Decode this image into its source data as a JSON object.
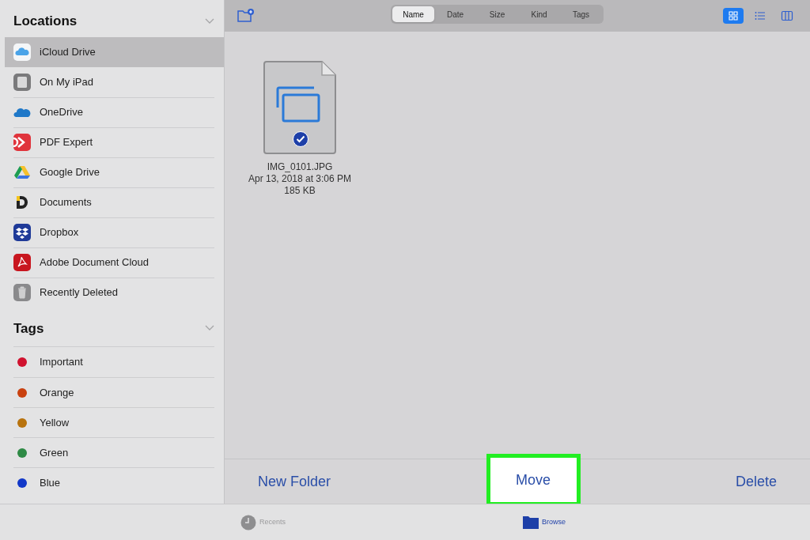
{
  "sidebar": {
    "sections": [
      {
        "title": "Locations",
        "kind": "locations",
        "items": [
          {
            "label": "iCloud Drive",
            "selected": true
          },
          {
            "label": "On My iPad",
            "selected": false
          },
          {
            "label": "OneDrive",
            "selected": false
          },
          {
            "label": "PDF Expert",
            "selected": false
          },
          {
            "label": "Google Drive",
            "selected": false
          },
          {
            "label": "Documents",
            "selected": false
          },
          {
            "label": "Dropbox",
            "selected": false
          },
          {
            "label": "Adobe Document Cloud",
            "selected": false
          },
          {
            "label": "Recently Deleted",
            "selected": false
          }
        ]
      },
      {
        "title": "Tags",
        "kind": "tags",
        "items": [
          {
            "label": "Important",
            "color": "#d0122f",
            "selected": false
          },
          {
            "label": "Orange",
            "color": "#c9410f",
            "selected": false
          },
          {
            "label": "Yellow",
            "color": "#b8730e",
            "selected": false
          },
          {
            "label": "Green",
            "color": "#2e8a45",
            "selected": false
          },
          {
            "label": "Blue",
            "color": "#1238c8",
            "selected": false
          }
        ]
      }
    ]
  },
  "sort_tabs": [
    {
      "label": "Name",
      "selected": true
    },
    {
      "label": "Date",
      "selected": false
    },
    {
      "label": "Size",
      "selected": false
    },
    {
      "label": "Kind",
      "selected": false
    },
    {
      "label": "Tags",
      "selected": false
    }
  ],
  "view_modes": [
    {
      "kind": "grid",
      "selected": true
    },
    {
      "kind": "list",
      "selected": false
    },
    {
      "kind": "columns",
      "selected": false
    }
  ],
  "files": [
    {
      "name": "IMG_0101.JPG",
      "date": "Apr 13, 2018 at 3:06 PM",
      "size": "185 KB",
      "checked": true
    }
  ],
  "actions": [
    {
      "label": "New Folder",
      "highlighted": false
    },
    {
      "label": "Move",
      "highlighted": true
    },
    {
      "label": "Delete",
      "highlighted": false
    }
  ],
  "tab_bar": [
    {
      "label": "Recents",
      "kind": "recents",
      "selected": false
    },
    {
      "label": "Browse",
      "kind": "browse",
      "selected": true
    }
  ]
}
